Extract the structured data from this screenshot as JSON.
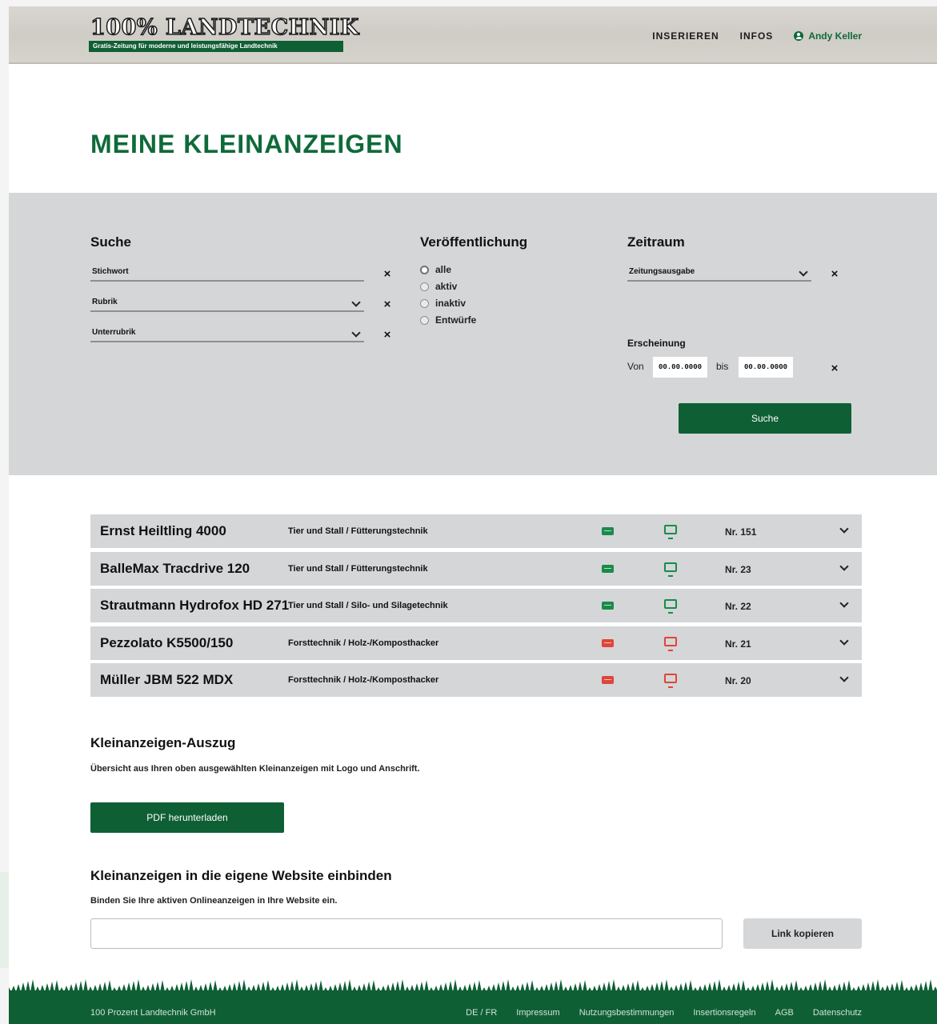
{
  "header": {
    "logo_title": "100% LANDTECHNIK",
    "logo_subtitle": "Gratis-Zeitung für moderne und leistungsfähige Landtechnik",
    "nav": {
      "insert": "INSERIEREN",
      "infos": "INFOS",
      "user": "Andy Keller"
    }
  },
  "page_title": "MEINE KLEINANZEIGEN",
  "filter": {
    "search": {
      "heading": "Suche",
      "keyword_placeholder": "Stichwort",
      "category": "Rubrik",
      "subcategory": "Unterrubrik"
    },
    "publication": {
      "heading": "Veröffentlichung",
      "options": [
        "alle",
        "aktiv",
        "inaktiv",
        "Entwürfe"
      ],
      "selected": "alle"
    },
    "period": {
      "heading": "Zeitraum",
      "issue": "Zeitungsausgabe",
      "appearance_heading": "Erscheinung",
      "from_label": "Von",
      "from_value": "00.00.0000",
      "to_label": "bis",
      "to_value": "00.00.0000"
    },
    "search_button": "Suche",
    "clear_symbol": "×"
  },
  "listings": [
    {
      "title": "Ernst Heiltling 4000",
      "category": "Tier und Stall / Fütterungstechnik",
      "status": "active",
      "number": "Nr. 151"
    },
    {
      "title": "BalleMax Tracdrive 120",
      "category": "Tier und Stall / Fütterungstechnik",
      "status": "active",
      "number": "Nr. 23"
    },
    {
      "title": "Strautmann Hydrofox HD 271",
      "category": "Tier und Stall / Silo- und Silagetechnik",
      "status": "active",
      "number": "Nr. 22"
    },
    {
      "title": "Pezzolato K5500/150",
      "category": "Forsttechnik / Holz-/Komposthacker",
      "status": "inactive",
      "number": "Nr. 21"
    },
    {
      "title": "Müller JBM 522 MDX",
      "category": "Forsttechnik / Holz-/Komposthacker",
      "status": "inactive",
      "number": "Nr. 20"
    }
  ],
  "icons": {
    "print": "print-icon",
    "online": "monitor-icon",
    "active_color": "#1a8a4a",
    "inactive_color": "#e0453a"
  },
  "excerpt": {
    "title": "Kleinanzeigen-Auszug",
    "text": "Übersicht aus Ihren oben ausgewählten Kleinanzeigen mit Logo und Anschrift.",
    "button": "PDF herunterladen"
  },
  "embed": {
    "title": "Kleinanzeigen in die eigene Website einbinden",
    "text": "Binden Sie Ihre aktiven Onlineanzeigen in Ihre Website ein.",
    "input_value": "",
    "button": "Link kopieren"
  },
  "footer": {
    "company": "100 Prozent Landtechnik GmbH",
    "links": [
      "DE / FR",
      "Impressum",
      "Nutzungsbestimmungen",
      "Insertionsregeln",
      "AGB",
      "Datenschutz"
    ]
  },
  "colors": {
    "brand_green": "#0f5f35",
    "title_green": "#0f6a3a",
    "panel_grey": "#d4d6d8"
  }
}
